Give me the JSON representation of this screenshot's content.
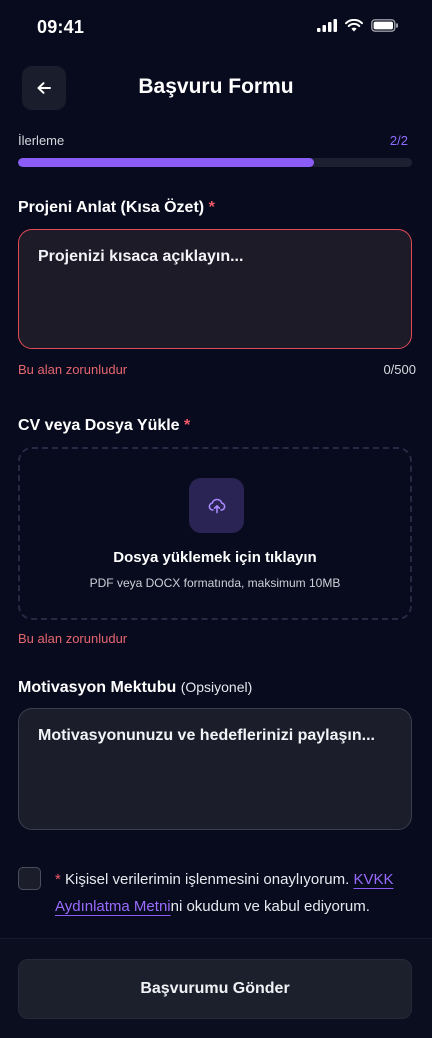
{
  "status_bar": {
    "time": "09:41"
  },
  "header": {
    "title": "Başvuru Formu"
  },
  "progress": {
    "label": "İlerleme",
    "count": "2/2",
    "fraction": 0.75
  },
  "project": {
    "label": "Projeni Anlat (Kısa Özet)",
    "required_mark": "*",
    "placeholder": "Projenizi kısaca açıklayın...",
    "error": "Bu alan zorunludur",
    "counter": "0/500"
  },
  "upload": {
    "label": "CV veya Dosya Yükle",
    "required_mark": "*",
    "title": "Dosya yüklemek için tıklayın",
    "subtitle": "PDF veya DOCX formatında, maksimum 10MB",
    "error": "Bu alan zorunludur"
  },
  "motivation": {
    "label": "Motivasyon Mektubu",
    "optional": "(Opsiyonel)",
    "placeholder": "Motivasyonunuzu ve hedeflerinizi paylaşın..."
  },
  "consent": {
    "required_mark": "*",
    "text_before": "Kişisel verilerimin işlenmesini onaylıyorum.",
    "link": "KVKK Aydınlatma Metni",
    "text_after": "ni okudum ve kabul ediyorum."
  },
  "submit": {
    "label": "Başvurumu Gönder"
  },
  "colors": {
    "accent": "#8b5cf6",
    "error": "#e14b57",
    "background": "#070b1d"
  }
}
